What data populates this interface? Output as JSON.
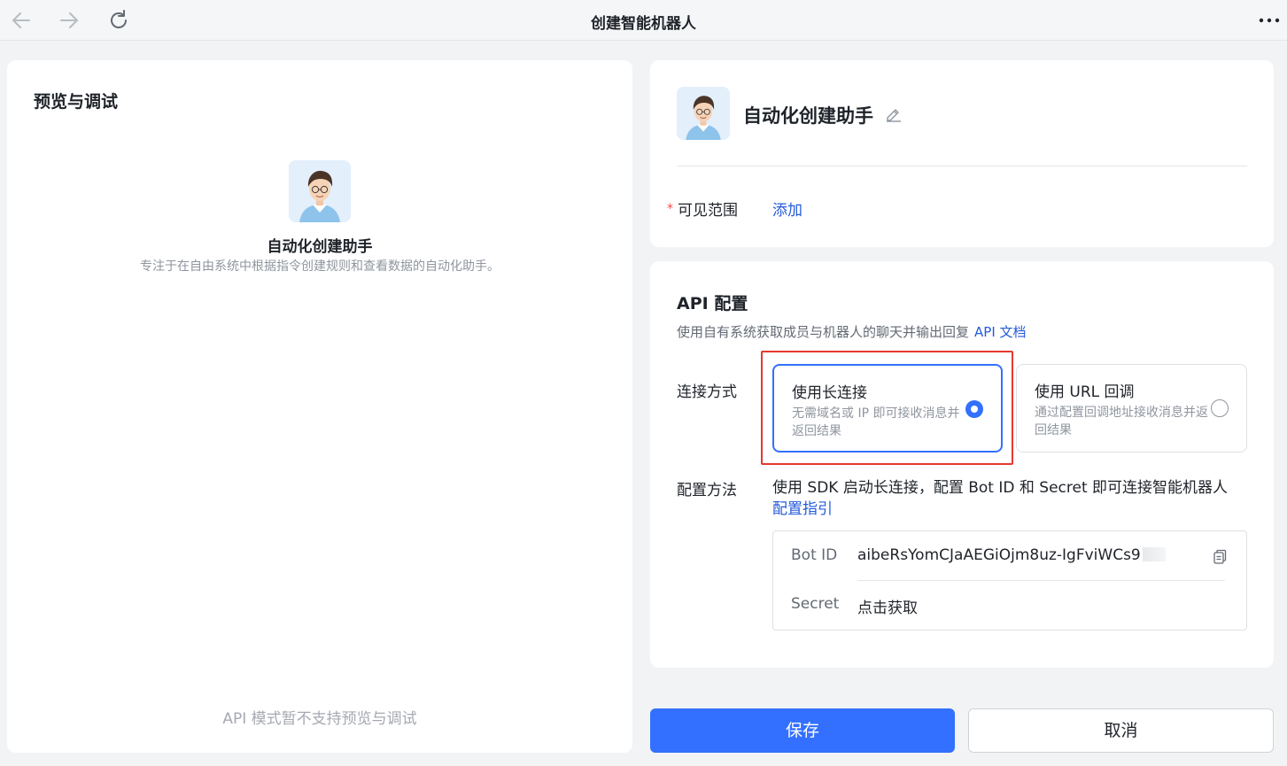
{
  "window": {
    "title": "创建智能机器人"
  },
  "preview": {
    "title": "预览与调试",
    "bot_name": "自动化创建助手",
    "bot_description": "专注于在自由系统中根据指令创建规则和查看数据的自动化助手。",
    "note": "API 模式暂不支持预览与调试"
  },
  "bot_info": {
    "name": "自动化创建助手",
    "visible_range_label": "可见范围",
    "required_mark": "*",
    "add_link": "添加"
  },
  "api_config": {
    "title": "API 配置",
    "description": "使用自有系统获取成员与机器人的聊天并输出回复",
    "doc_link": "API 文档",
    "connection_label": "连接方式",
    "options": [
      {
        "title": "使用长连接",
        "description": "无需域名或 IP 即可接收消息并返回结果",
        "selected": true
      },
      {
        "title": "使用 URL 回调",
        "description": "通过配置回调地址接收消息并返回结果",
        "selected": false
      }
    ],
    "method_label": "配置方法",
    "method_text": "使用 SDK 启动长连接，配置 Bot ID 和 Secret 即可连接智能机器人",
    "guide_link": "配置指引",
    "bot_id_label": "Bot ID",
    "bot_id_value": "aibeRsYomCJaAEGiOjm8uz-IgFviWCs9",
    "secret_label": "Secret",
    "secret_link": "点击获取"
  },
  "buttons": {
    "save": "保存",
    "cancel": "取消"
  },
  "colors": {
    "primary": "#3370ff",
    "link": "#245bdb",
    "highlight_border": "#e5392f",
    "required": "#f54a45"
  },
  "icons": [
    "back-arrow-icon",
    "forward-arrow-icon",
    "refresh-icon",
    "more-icon",
    "edit-icon",
    "copy-icon"
  ]
}
